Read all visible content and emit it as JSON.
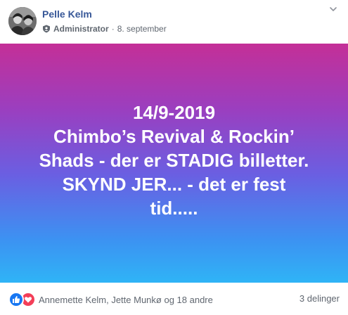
{
  "post": {
    "author": {
      "name": "Pelle Kelm",
      "avatar_icon": "profile-photo-icon"
    },
    "meta": {
      "role": "Administrator",
      "separator": "·",
      "date": "8. september"
    },
    "banner": {
      "lines": [
        "14/9-2019",
        "Chimbo’s Revival & Rockin’",
        "Shads - der er STADIG billetter.",
        "SKYND JER... - det er fest",
        "tid....."
      ],
      "gradient_top": "#c42f97",
      "gradient_bottom": "#2fb4f6",
      "text_color": "#ffffff"
    },
    "footer": {
      "reaction_icons": [
        "like-icon",
        "love-icon"
      ],
      "reaction_names": "Annemette Kelm, Jette Munkø og 18 andre",
      "shares": "3 delinger"
    }
  }
}
